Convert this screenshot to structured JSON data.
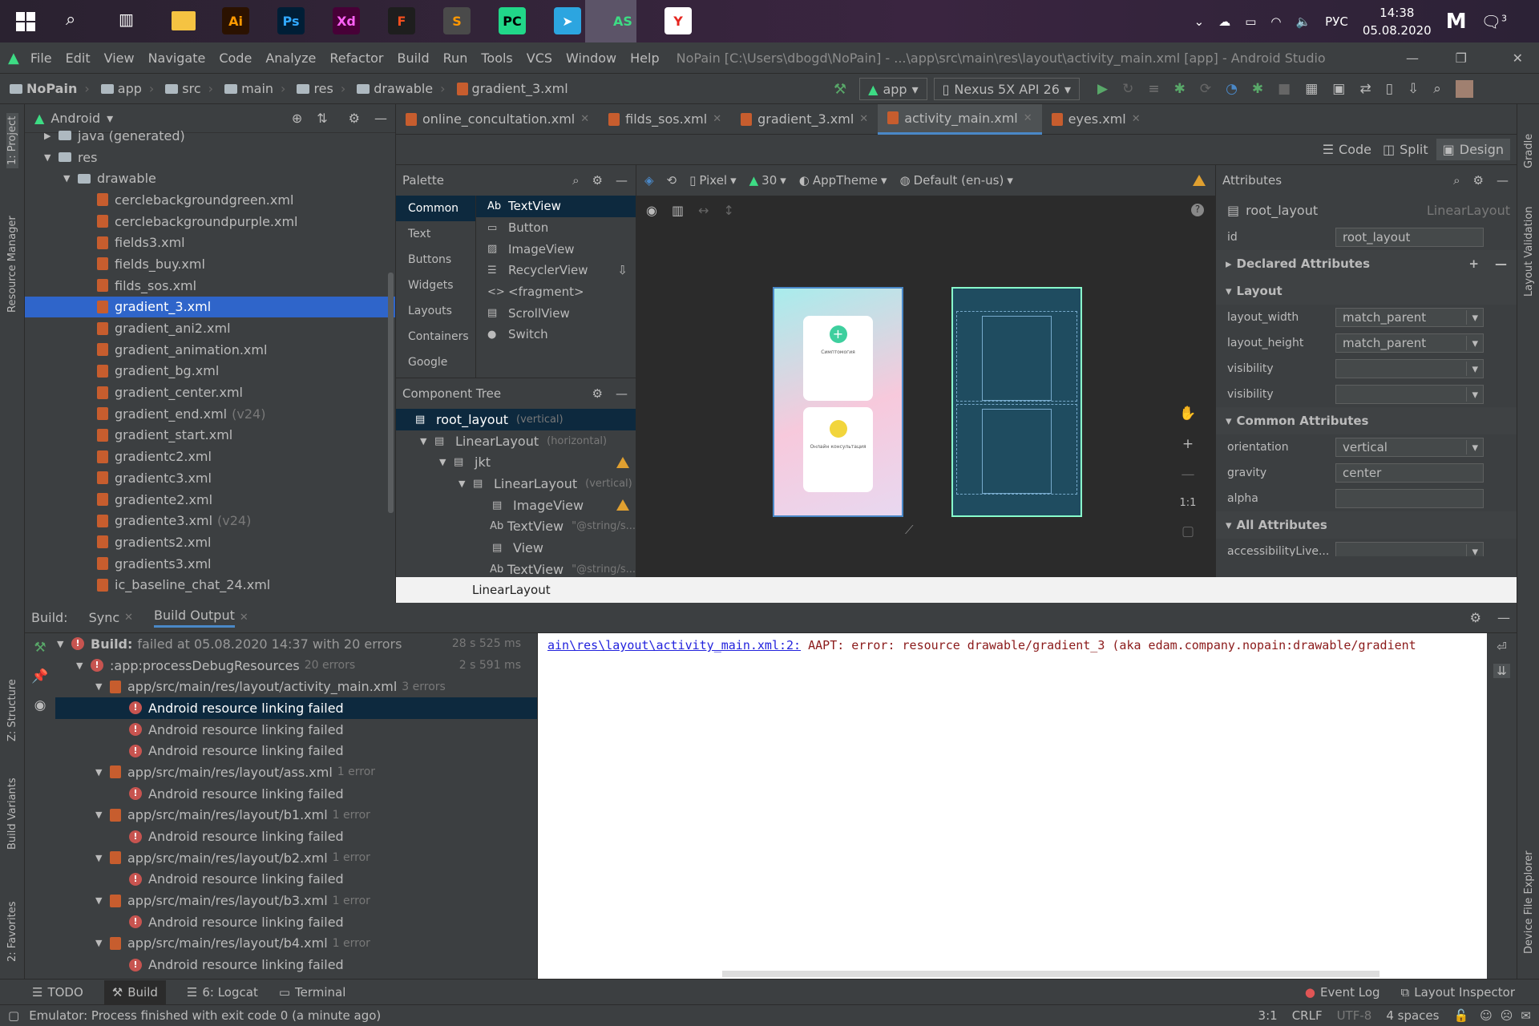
{
  "taskbar": {
    "time": "14:38",
    "date": "05.08.2020",
    "lang": "РУС",
    "notifications": "3",
    "apps": [
      {
        "name": "Ai",
        "color": "#2b1200",
        "fg": "#ff9a00"
      },
      {
        "name": "Ps",
        "color": "#001e36",
        "fg": "#31a8ff"
      },
      {
        "name": "Xd",
        "color": "#470137",
        "fg": "#ff61f6"
      },
      {
        "name": "F",
        "color": "#1e1e1e",
        "fg": "#f24e1e"
      },
      {
        "name": "S",
        "color": "#4a4a4a",
        "fg": "#ff9800"
      },
      {
        "name": "PC",
        "color": "#21d789",
        "fg": "#000"
      },
      {
        "name": "➤",
        "color": "#2ca5e0",
        "fg": "#fff"
      },
      {
        "name": "AS",
        "color": "#5c5468",
        "fg": "#3ddc84"
      },
      {
        "name": "Y",
        "color": "#fff",
        "fg": "#e52620"
      }
    ]
  },
  "menu": {
    "items": [
      "File",
      "Edit",
      "View",
      "Navigate",
      "Code",
      "Analyze",
      "Refactor",
      "Build",
      "Run",
      "Tools",
      "VCS",
      "Window",
      "Help"
    ],
    "title": "NoPain [C:\\Users\\dbogd\\NoPain] - ...\\app\\src\\main\\res\\layout\\activity_main.xml [app] - Android Studio"
  },
  "breadcrumb": [
    "NoPain",
    "app",
    "src",
    "main",
    "res",
    "drawable",
    "gradient_3.xml"
  ],
  "toolbar": {
    "run_config": "app",
    "device": "Nexus 5X API 26"
  },
  "project": {
    "view": "Android",
    "items": [
      {
        "label": "java (generated)",
        "indent": 1,
        "type": "folder"
      },
      {
        "label": "res",
        "indent": 1,
        "type": "folder",
        "open": true
      },
      {
        "label": "drawable",
        "indent": 2,
        "type": "folder",
        "open": true
      },
      {
        "label": "cerclebackgroundgreen.xml",
        "indent": 3
      },
      {
        "label": "cerclebackgroundpurple.xml",
        "indent": 3
      },
      {
        "label": "fields3.xml",
        "indent": 3
      },
      {
        "label": "fields_buy.xml",
        "indent": 3
      },
      {
        "label": "filds_sos.xml",
        "indent": 3
      },
      {
        "label": "gradient_3.xml",
        "indent": 3,
        "selected": true
      },
      {
        "label": "gradient_ani2.xml",
        "indent": 3
      },
      {
        "label": "gradient_animation.xml",
        "indent": 3
      },
      {
        "label": "gradient_bg.xml",
        "indent": 3
      },
      {
        "label": "gradient_center.xml",
        "indent": 3
      },
      {
        "label": "gradient_end.xml",
        "indent": 3,
        "suffix": "(v24)"
      },
      {
        "label": "gradient_start.xml",
        "indent": 3
      },
      {
        "label": "gradientc2.xml",
        "indent": 3
      },
      {
        "label": "gradientc3.xml",
        "indent": 3
      },
      {
        "label": "gradiente2.xml",
        "indent": 3
      },
      {
        "label": "gradiente3.xml",
        "indent": 3,
        "suffix": "(v24)"
      },
      {
        "label": "gradients2.xml",
        "indent": 3
      },
      {
        "label": "gradients3.xml",
        "indent": 3
      },
      {
        "label": "ic_baseline_chat_24.xml",
        "indent": 3
      }
    ]
  },
  "left_strip": [
    "1: Project",
    "Resource Manager",
    "Z: Structure",
    "Build Variants",
    "2: Favorites"
  ],
  "right_strip": [
    "Gradle",
    "Layout Validation",
    "Device File Explorer"
  ],
  "tabs": [
    {
      "label": "online_concultation.xml"
    },
    {
      "label": "filds_sos.xml"
    },
    {
      "label": "gradient_3.xml"
    },
    {
      "label": "activity_main.xml",
      "active": true
    },
    {
      "label": "eyes.xml"
    }
  ],
  "modes": {
    "code": "Code",
    "split": "Split",
    "design": "Design"
  },
  "palette": {
    "title": "Palette",
    "categories": [
      "Common",
      "Text",
      "Buttons",
      "Widgets",
      "Layouts",
      "Containers",
      "Google"
    ],
    "items": [
      {
        "icon": "Ab",
        "label": "TextView"
      },
      {
        "icon": "▭",
        "label": "Button"
      },
      {
        "icon": "▨",
        "label": "ImageView"
      },
      {
        "icon": "☰",
        "label": "RecyclerView"
      },
      {
        "icon": "<>",
        "label": "<fragment>"
      },
      {
        "icon": "▤",
        "label": "ScrollView"
      },
      {
        "icon": "●",
        "label": "Switch"
      }
    ]
  },
  "component_tree": {
    "title": "Component Tree",
    "items": [
      {
        "label": "root_layout",
        "hint": "(vertical)",
        "indent": 0,
        "selected": true
      },
      {
        "label": "LinearLayout",
        "hint": "(horizontal)",
        "indent": 1
      },
      {
        "label": "jkt",
        "hint": "",
        "indent": 2,
        "warn": true
      },
      {
        "label": "LinearLayout",
        "hint": "(vertical)",
        "indent": 3
      },
      {
        "label": "ImageView",
        "hint": "",
        "indent": 4,
        "warn": true
      },
      {
        "label": "TextView",
        "hint": "\"@string/s...",
        "indent": 4
      },
      {
        "label": "View",
        "hint": "",
        "indent": 4
      },
      {
        "label": "TextView",
        "hint": "\"@string/s...",
        "indent": 4
      }
    ]
  },
  "design_toolbar": {
    "device": "Pixel",
    "api": "30",
    "theme": "AppTheme",
    "locale": "Default (en-us)"
  },
  "preview": {
    "card1_title": "Симптомогия",
    "card2_title": "Онлайн консультация",
    "zoom_ratio": "1:1"
  },
  "attributes": {
    "title": "Attributes",
    "component": "root_layout",
    "component_type": "LinearLayout",
    "id_label": "id",
    "id": "root_layout",
    "sections": {
      "declared": "Declared Attributes",
      "layout": "Layout",
      "common": "Common Attributes",
      "all": "All Attributes"
    },
    "layout": [
      {
        "label": "layout_width",
        "value": "match_parent"
      },
      {
        "label": "layout_height",
        "value": "match_parent"
      },
      {
        "label": "visibility",
        "value": ""
      },
      {
        "label": "visibility",
        "value": ""
      }
    ],
    "common": [
      {
        "label": "orientation",
        "value": "vertical"
      },
      {
        "label": "gravity",
        "value": "center"
      },
      {
        "label": "alpha",
        "value": ""
      }
    ],
    "all": [
      {
        "label": "accessibilityLive...",
        "value": ""
      }
    ]
  },
  "status_strip": "LinearLayout",
  "build": {
    "tabs": [
      "Build:",
      "Sync",
      "Build Output"
    ],
    "rows": [
      {
        "label": "Build:",
        "rest": "failed at 05.08.2020 14:37 with 20 errors",
        "time": "28 s 525 ms",
        "indent": 0,
        "icon": "err",
        "bold": true
      },
      {
        "label": ":app:processDebugResources",
        "rest": "20 errors",
        "time": "2 s 591 ms",
        "indent": 1,
        "icon": "err"
      },
      {
        "label": "app/src/main/res/layout/activity_main.xml",
        "rest": "3 errors",
        "indent": 2,
        "icon": "file"
      },
      {
        "label": "Android resource linking failed",
        "indent": 3,
        "icon": "err",
        "selected": true
      },
      {
        "label": "Android resource linking failed",
        "indent": 3,
        "icon": "err"
      },
      {
        "label": "Android resource linking failed",
        "indent": 3,
        "icon": "err"
      },
      {
        "label": "app/src/main/res/layout/ass.xml",
        "rest": "1 error",
        "indent": 2,
        "icon": "file"
      },
      {
        "label": "Android resource linking failed",
        "indent": 3,
        "icon": "err"
      },
      {
        "label": "app/src/main/res/layout/b1.xml",
        "rest": "1 error",
        "indent": 2,
        "icon": "file"
      },
      {
        "label": "Android resource linking failed",
        "indent": 3,
        "icon": "err"
      },
      {
        "label": "app/src/main/res/layout/b2.xml",
        "rest": "1 error",
        "indent": 2,
        "icon": "file"
      },
      {
        "label": "Android resource linking failed",
        "indent": 3,
        "icon": "err"
      },
      {
        "label": "app/src/main/res/layout/b3.xml",
        "rest": "1 error",
        "indent": 2,
        "icon": "file"
      },
      {
        "label": "Android resource linking failed",
        "indent": 3,
        "icon": "err"
      },
      {
        "label": "app/src/main/res/layout/b4.xml",
        "rest": "1 error",
        "indent": 2,
        "icon": "file"
      },
      {
        "label": "Android resource linking failed",
        "indent": 3,
        "icon": "err"
      }
    ],
    "output_link": "ain\\res\\layout\\activity_main.xml:2:",
    "output_msg": " AAPT: error: resource drawable/gradient_3 (aka edam.company.nopain:drawable/gradient"
  },
  "bottom_tabs": {
    "todo": "TODO",
    "build": "Build",
    "logcat": "6: Logcat",
    "terminal": "Terminal",
    "event_log": "Event Log",
    "layout_inspector": "Layout Inspector"
  },
  "status": {
    "message": "Emulator: Process finished with exit code 0 (a minute ago)",
    "position": "3:1",
    "line_sep": "CRLF",
    "encoding": "UTF-8",
    "indent": "4 spaces"
  }
}
